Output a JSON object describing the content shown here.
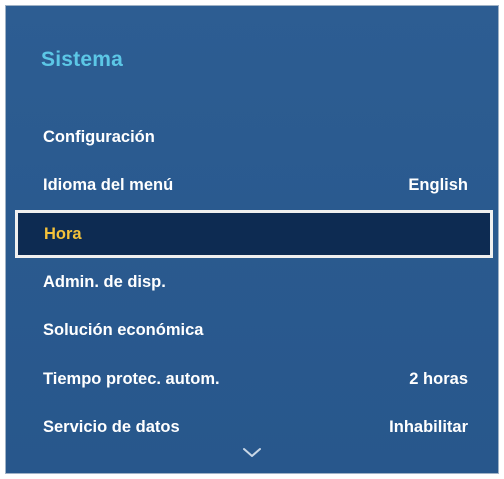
{
  "panel": {
    "title": "Sistema"
  },
  "menu": {
    "items": [
      {
        "label": "Configuración",
        "value": ""
      },
      {
        "label": "Idioma del menú",
        "value": "English"
      },
      {
        "label": "Hora",
        "value": ""
      },
      {
        "label": "Admin. de disp.",
        "value": ""
      },
      {
        "label": "Solución económica",
        "value": ""
      },
      {
        "label": "Tiempo protec. autom.",
        "value": "2 horas"
      },
      {
        "label": "Servicio de datos",
        "value": "Inhabilitar"
      }
    ],
    "selected_index": 2,
    "scroll_icon": "chevron-down-icon"
  },
  "colors": {
    "panel_background": "#2a5a8f",
    "title": "#5cc7e6",
    "item_text": "#ffffff",
    "selected_background": "#0d2b52",
    "selected_text": "#f4c23a",
    "selected_border": "#f0f0f0"
  }
}
